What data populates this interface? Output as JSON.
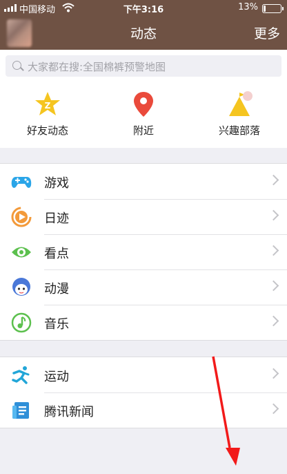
{
  "status_bar": {
    "carrier": "中国移动",
    "time": "下午3:16",
    "battery": "13%",
    "battery_level": 0.13
  },
  "nav": {
    "title": "动态",
    "more": "更多"
  },
  "search": {
    "placeholder": "大家都在搜:全国棉裤预警地图"
  },
  "quick_links": [
    {
      "label": "好友动态",
      "icon": "friend-star-icon"
    },
    {
      "label": "附近",
      "icon": "location-pin-icon"
    },
    {
      "label": "兴趣部落",
      "icon": "tribe-flag-icon"
    }
  ],
  "list_group_1": [
    {
      "label": "游戏",
      "icon": "gamepad-icon"
    },
    {
      "label": "日迹",
      "icon": "play-circle-icon"
    },
    {
      "label": "看点",
      "icon": "eye-icon"
    },
    {
      "label": "动漫",
      "icon": "anime-face-icon"
    },
    {
      "label": "音乐",
      "icon": "music-note-icon"
    }
  ],
  "list_group_2": [
    {
      "label": "运动",
      "icon": "running-icon"
    },
    {
      "label": "腾讯新闻",
      "icon": "news-icon"
    }
  ],
  "colors": {
    "header": "#6f5244",
    "background": "#efeff4",
    "accent_yellow": "#f5c520",
    "accent_red": "#ea4a3b",
    "accent_green": "#5cc04e",
    "accent_blue": "#2aa5e8",
    "annotation_arrow": "#f21a1a"
  }
}
